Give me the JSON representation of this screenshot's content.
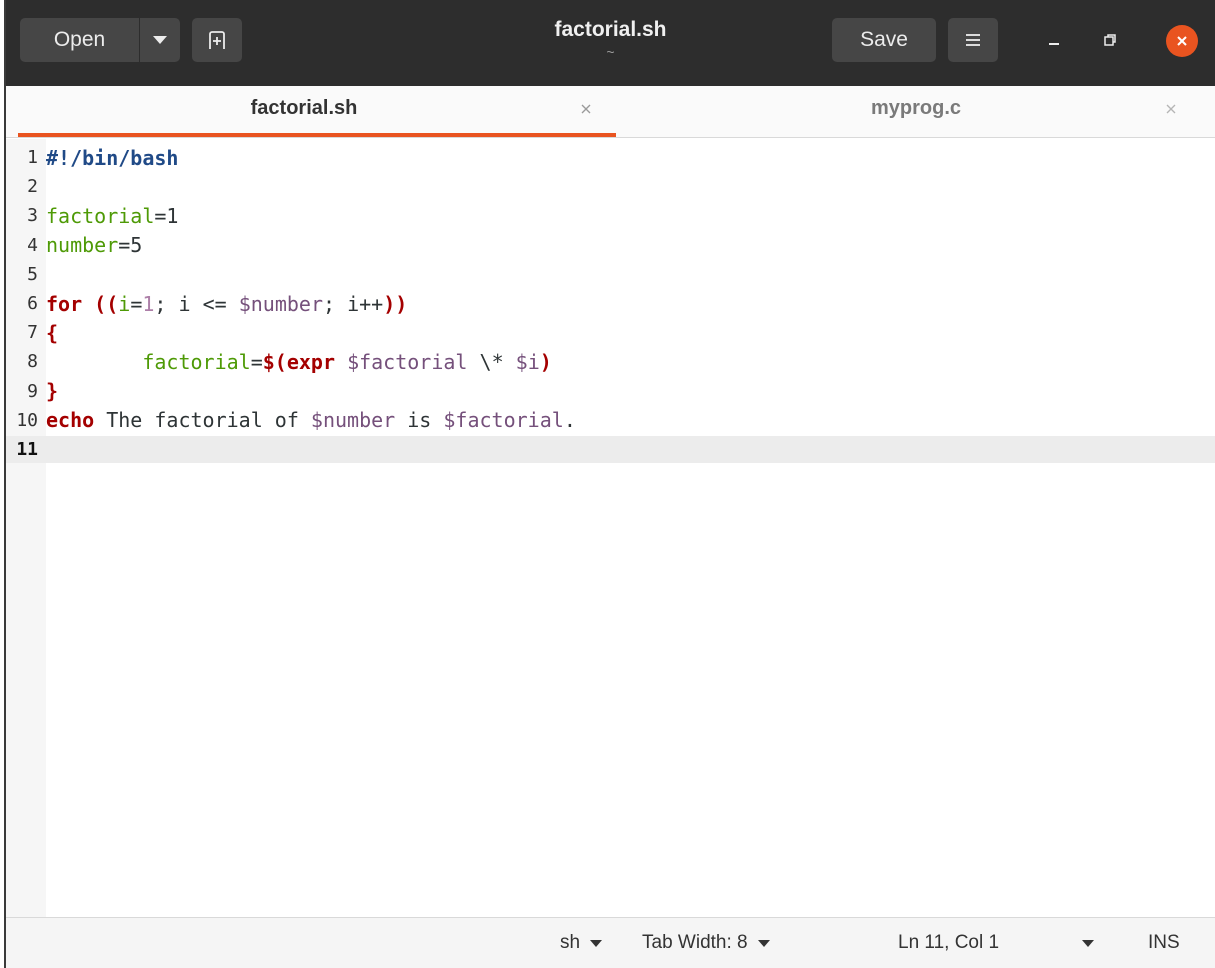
{
  "header": {
    "open_label": "Open",
    "title": "factorial.sh",
    "subtitle": "~",
    "save_label": "Save"
  },
  "tabs": [
    {
      "label": "factorial.sh",
      "active": true
    },
    {
      "label": "myprog.c",
      "active": false
    }
  ],
  "editor": {
    "current_line": 11,
    "lines": [
      {
        "n": "1",
        "tokens": [
          {
            "t": "#!/bin/bash",
            "c": "sb"
          }
        ]
      },
      {
        "n": "2",
        "tokens": []
      },
      {
        "n": "3",
        "tokens": [
          {
            "t": "factorial",
            "c": "var"
          },
          {
            "t": "=1",
            "c": "code"
          }
        ]
      },
      {
        "n": "4",
        "tokens": [
          {
            "t": "number",
            "c": "var"
          },
          {
            "t": "=5",
            "c": "code"
          }
        ]
      },
      {
        "n": "5",
        "tokens": []
      },
      {
        "n": "6",
        "tokens": [
          {
            "t": "for",
            "c": "kw"
          },
          {
            "t": " ",
            "c": "code"
          },
          {
            "t": "((",
            "c": "par"
          },
          {
            "t": "i",
            "c": "var"
          },
          {
            "t": "=",
            "c": "code"
          },
          {
            "t": "1",
            "c": "num"
          },
          {
            "t": "; i <= ",
            "c": "code"
          },
          {
            "t": "$number",
            "c": "dv"
          },
          {
            "t": "; i++",
            "c": "code"
          },
          {
            "t": "))",
            "c": "par"
          }
        ]
      },
      {
        "n": "7",
        "tokens": [
          {
            "t": "{",
            "c": "kw"
          }
        ]
      },
      {
        "n": "8",
        "tokens": [
          {
            "t": "        ",
            "c": "code"
          },
          {
            "t": "factorial",
            "c": "var"
          },
          {
            "t": "=",
            "c": "code"
          },
          {
            "t": "$(",
            "c": "kw"
          },
          {
            "t": "expr",
            "c": "kw"
          },
          {
            "t": " ",
            "c": "code"
          },
          {
            "t": "$factorial",
            "c": "dv"
          },
          {
            "t": " \\* ",
            "c": "code"
          },
          {
            "t": "$i",
            "c": "dv"
          },
          {
            "t": ")",
            "c": "kw"
          }
        ]
      },
      {
        "n": "9",
        "tokens": [
          {
            "t": "}",
            "c": "kw"
          }
        ]
      },
      {
        "n": "10",
        "tokens": [
          {
            "t": "echo",
            "c": "kw"
          },
          {
            "t": " The factorial of ",
            "c": "code"
          },
          {
            "t": "$number",
            "c": "dv"
          },
          {
            "t": " is ",
            "c": "code"
          },
          {
            "t": "$factorial",
            "c": "dv"
          },
          {
            "t": ".",
            "c": "code"
          }
        ]
      },
      {
        "n": "11",
        "tokens": []
      }
    ]
  },
  "statusbar": {
    "language": "sh",
    "tab_width": "Tab Width: 8",
    "position": "Ln 11, Col 1",
    "mode": "INS"
  },
  "colors": {
    "accent": "#e95420",
    "headerbar": "#2d2d2d"
  }
}
